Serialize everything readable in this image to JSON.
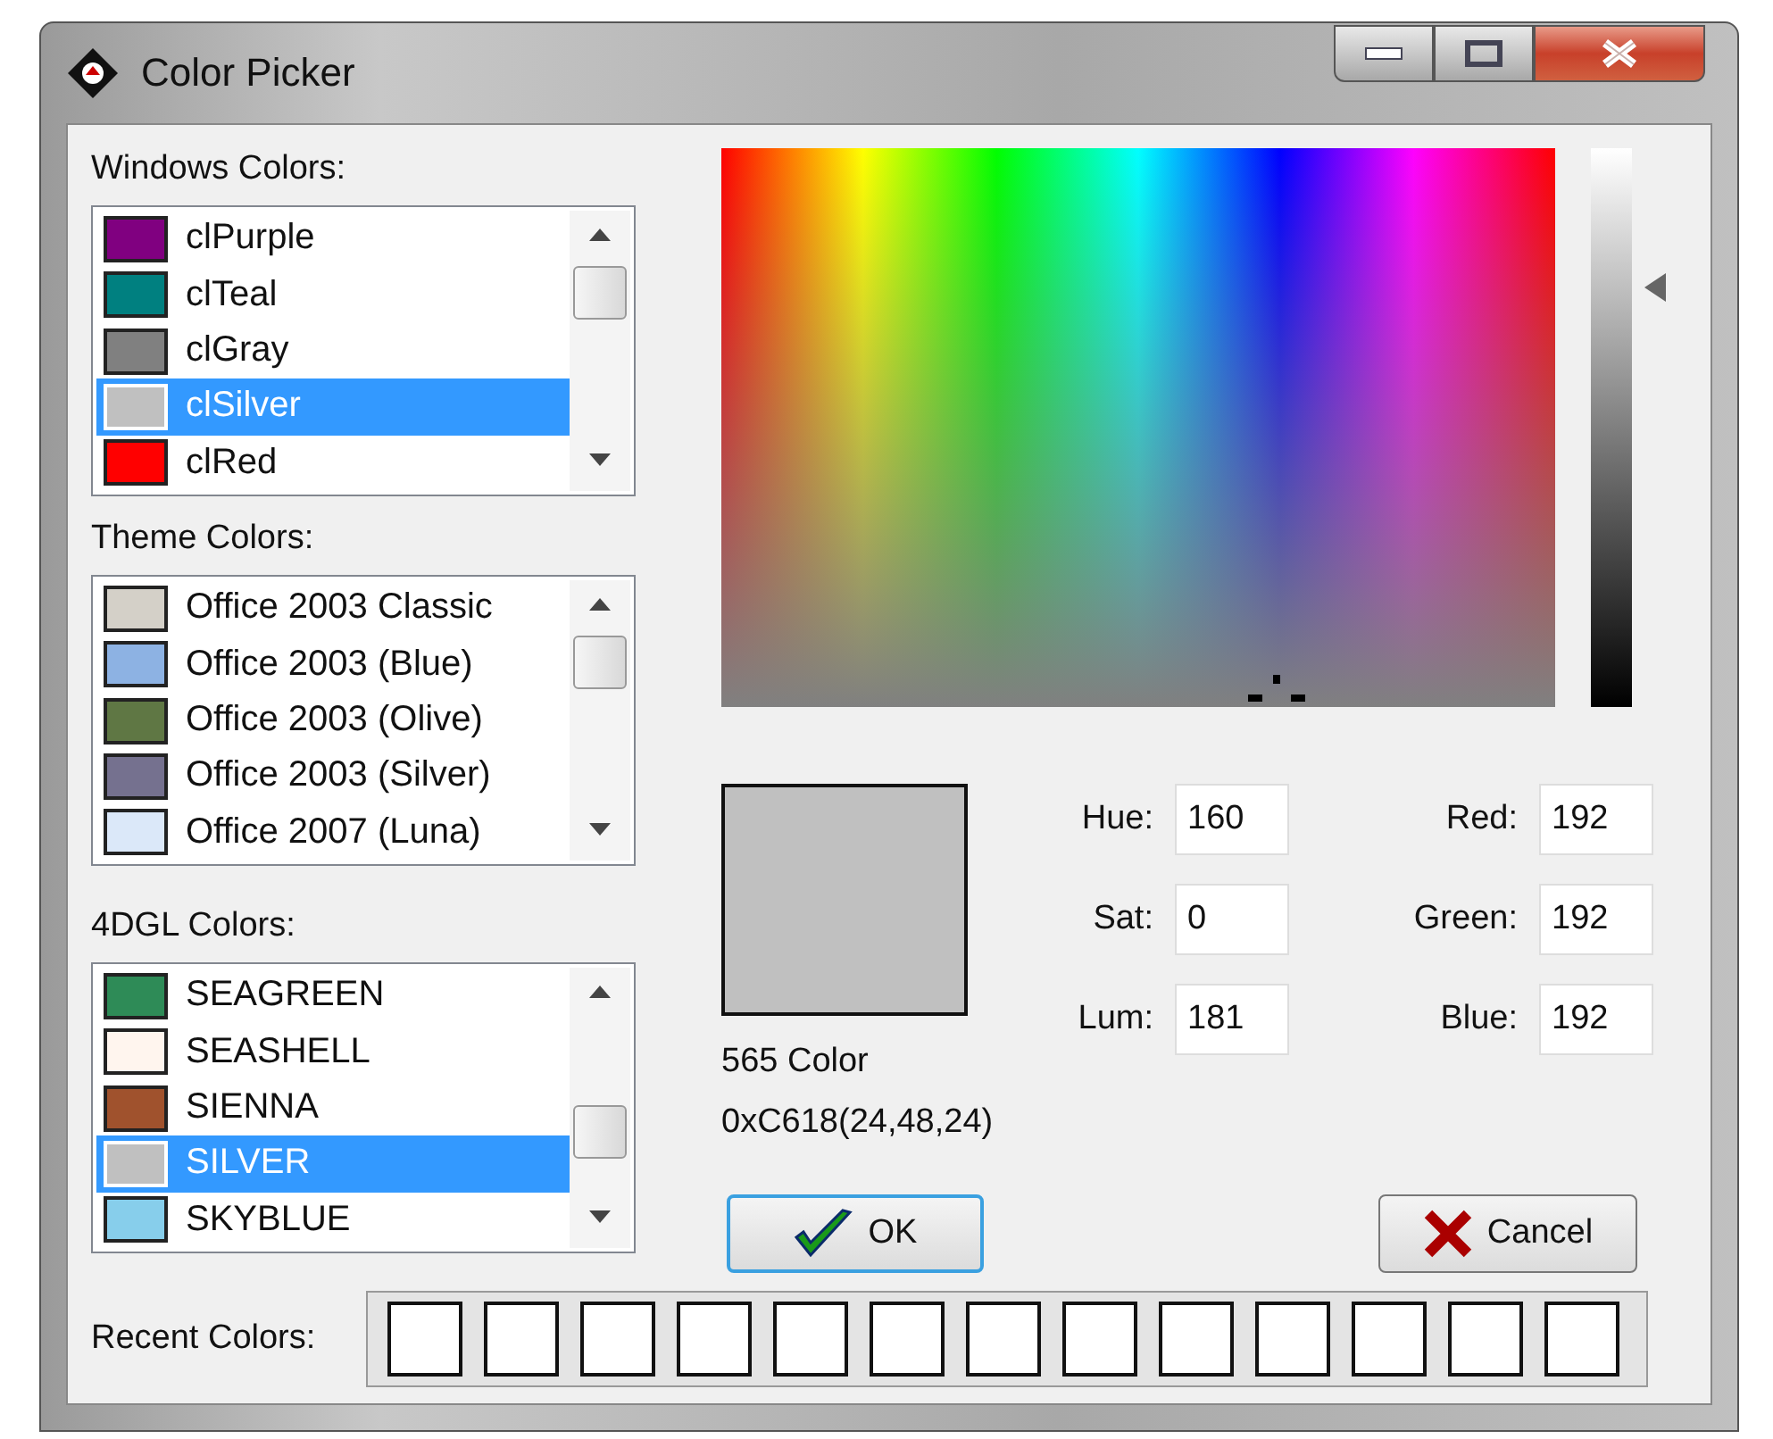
{
  "window": {
    "title": "Color Picker"
  },
  "lists": [
    {
      "label": "Windows Colors:",
      "items": [
        {
          "name": "clPurple",
          "color": "#800080",
          "selected": false
        },
        {
          "name": "clTeal",
          "color": "#008080",
          "selected": false
        },
        {
          "name": "clGray",
          "color": "#808080",
          "selected": false
        },
        {
          "name": "clSilver",
          "color": "#c0c0c0",
          "selected": true
        },
        {
          "name": "clRed",
          "color": "#ff0000",
          "selected": false
        }
      ]
    },
    {
      "label": "Theme Colors:",
      "items": [
        {
          "name": "Office 2003 Classic",
          "color": "#d4d0c8",
          "selected": false
        },
        {
          "name": "Office 2003 (Blue)",
          "color": "#8db2e3",
          "selected": false
        },
        {
          "name": "Office 2003 (Olive)",
          "color": "#5f7744",
          "selected": false
        },
        {
          "name": "Office 2003 (Silver)",
          "color": "#75718f",
          "selected": false
        },
        {
          "name": "Office 2007 (Luna)",
          "color": "#dbe8f9",
          "selected": false
        }
      ]
    },
    {
      "label": "4DGL Colors:",
      "items": [
        {
          "name": "SEAGREEN",
          "color": "#2e8b57",
          "selected": false
        },
        {
          "name": "SEASHELL",
          "color": "#fff5ee",
          "selected": false
        },
        {
          "name": "SIENNA",
          "color": "#a0522d",
          "selected": false
        },
        {
          "name": "SILVER",
          "color": "#c0c0c0",
          "selected": true
        },
        {
          "name": "SKYBLUE",
          "color": "#87ceeb",
          "selected": false
        }
      ]
    }
  ],
  "luminance_slider": {
    "level": 0.75
  },
  "preview": {
    "color": "#c0c0c0",
    "format": "565 Color",
    "code": "0xC618(24,48,24)"
  },
  "fields": [
    {
      "label": "Hue:",
      "value": "160"
    },
    {
      "label": "Red:",
      "value": "192"
    },
    {
      "label": "Sat:",
      "value": "0"
    },
    {
      "label": "Green:",
      "value": "192"
    },
    {
      "label": "Lum:",
      "value": "181"
    },
    {
      "label": "Blue:",
      "value": "192"
    }
  ],
  "buttons": {
    "ok": "OK",
    "cancel": "Cancel"
  },
  "recent_colors": {
    "label": "Recent Colors:",
    "slots": [
      {
        "color": "#ffffff"
      },
      {
        "color": "#ffffff"
      },
      {
        "color": "#ffffff"
      },
      {
        "color": "#ffffff"
      },
      {
        "color": "#ffffff"
      },
      {
        "color": "#ffffff"
      },
      {
        "color": "#ffffff"
      },
      {
        "color": "#ffffff"
      },
      {
        "color": "#ffffff"
      },
      {
        "color": "#ffffff"
      },
      {
        "color": "#ffffff"
      },
      {
        "color": "#ffffff"
      },
      {
        "color": "#ffffff"
      }
    ]
  }
}
